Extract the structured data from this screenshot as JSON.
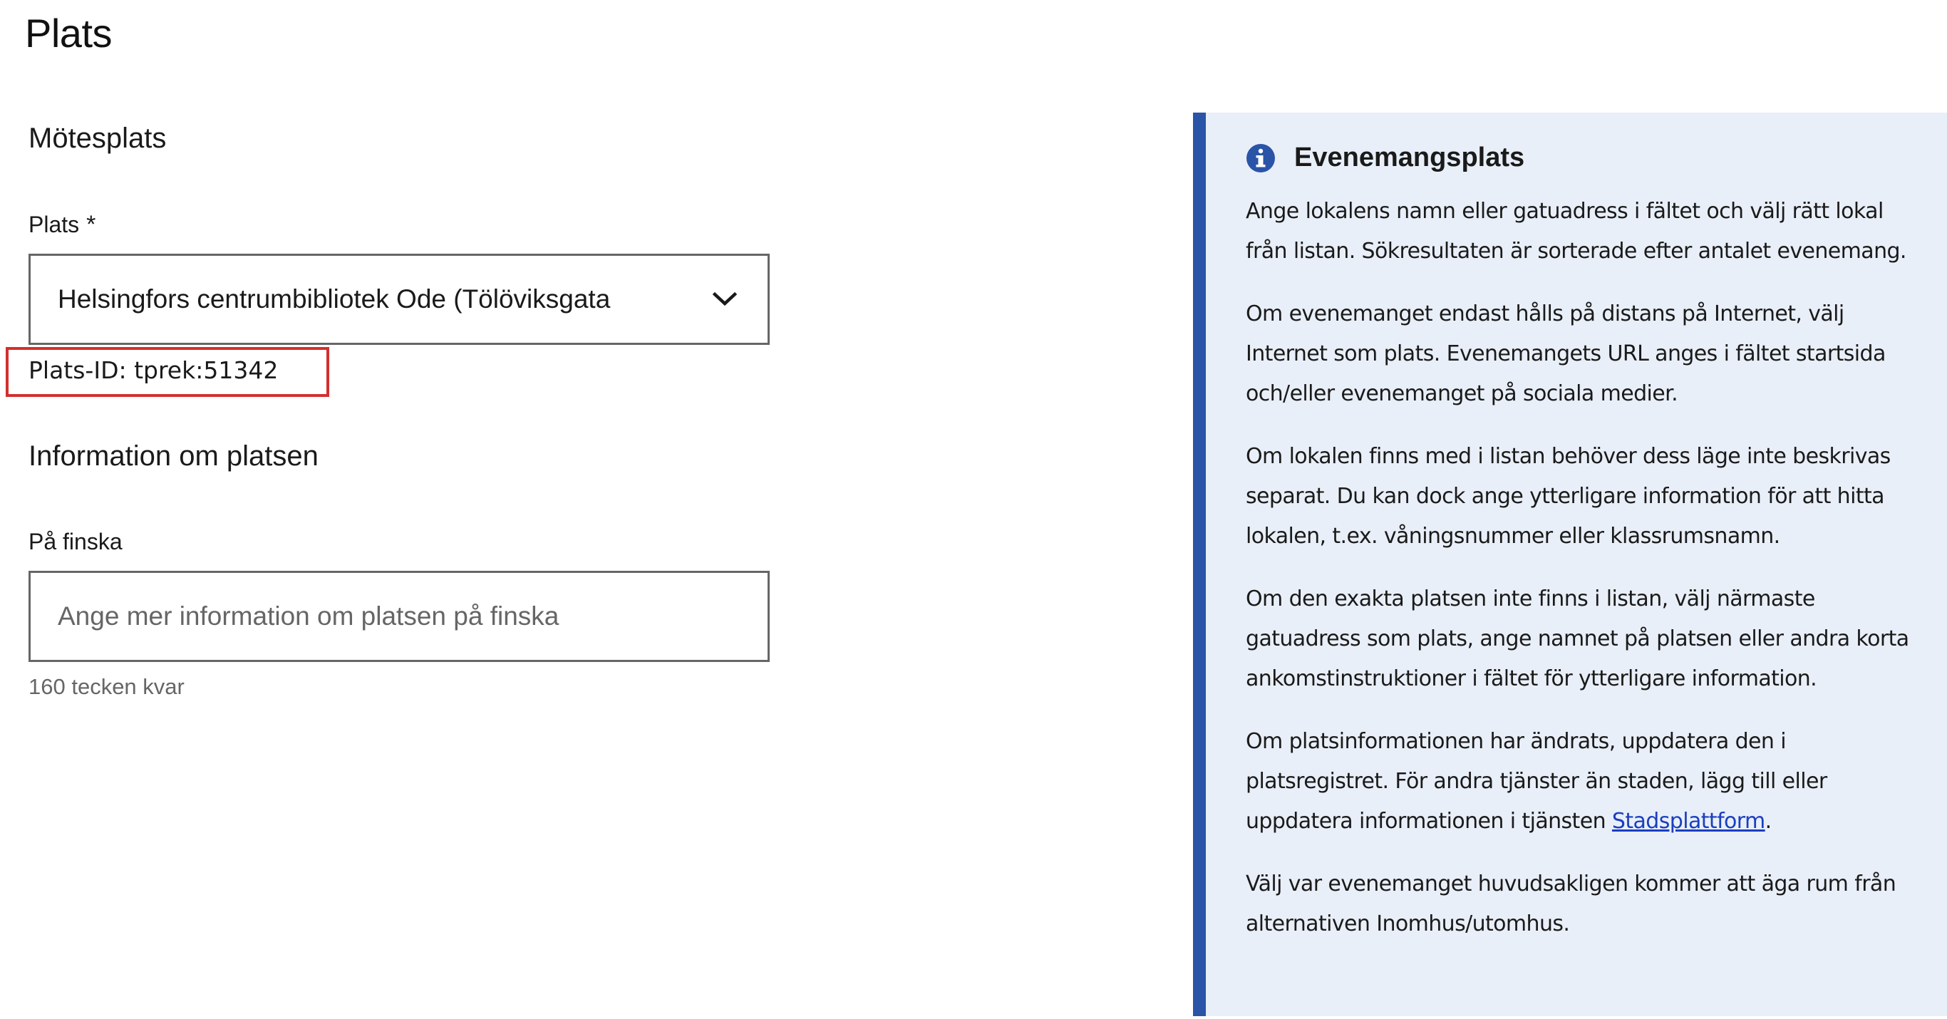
{
  "page": {
    "title": "Plats"
  },
  "meeting_place": {
    "heading": "Mötesplats",
    "place_label": "Plats",
    "required_marker": "*",
    "selected_value": "Helsingfors centrumbibliotek Ode (Tölöviksgata",
    "place_id_text": "Plats-ID: tprek:51342"
  },
  "place_info": {
    "heading": "Information om platsen",
    "finnish_label": "På finska",
    "finnish_placeholder": "Ange mer information om platsen på finska",
    "finnish_value": "",
    "chars_left": "160 tecken kvar"
  },
  "info_panel": {
    "icon": "info-icon",
    "title": "Evenemangsplats",
    "paragraphs": [
      "Ange lokalens namn eller gatuadress i fältet och välj rätt lokal från listan. Sökresultaten är sorterade efter antalet evenemang.",
      "Om evenemanget endast hålls på distans på Internet, välj Internet som plats. Evenemangets URL anges i fältet startsida och/eller evenemanget på sociala medier.",
      "Om lokalen finns med i listan behöver dess läge inte beskrivas separat. Du kan dock ange ytterligare information för att hitta lokalen, t.ex. våningsnummer eller klassrumsnamn.",
      "Om den exakta platsen inte finns i listan, välj närmaste gatuadress som plats, ange namnet på platsen eller andra korta ankomstinstruktioner i fältet för ytterligare information."
    ],
    "para5_before_link": "Om platsinformationen har ändrats, uppdatera den i platsregistret. För andra tjänster än staden, lägg till eller uppdatera informationen i tjänsten ",
    "para5_link": "Stadsplattform",
    "para5_after_link": ".",
    "para6": "Välj var evenemanget huvudsakligen kommer att äga rum från alternativen Inomhus/utomhus."
  },
  "colors": {
    "accent_border": "#2a54a8",
    "panel_background": "#e9eff8",
    "highlight": "#d32f2f",
    "link": "#1a3fbf"
  }
}
